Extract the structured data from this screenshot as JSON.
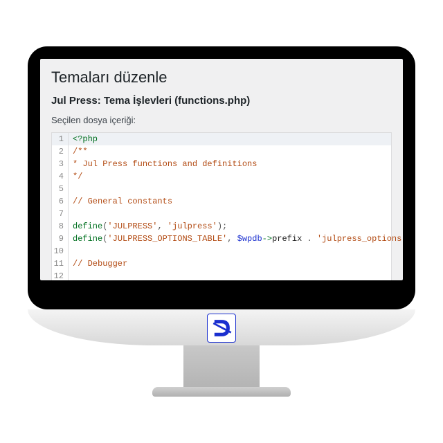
{
  "page": {
    "heading": "Temaları düzenle",
    "subheading": "Jul Press: Tema İşlevleri (functions.php)",
    "file_label": "Seçilen dosya içeriği:"
  },
  "colors": {
    "logo": "#1a2fcf"
  },
  "editor": {
    "active_line": 1,
    "lines": [
      {
        "n": 1,
        "tokens": [
          [
            "k",
            "<?php"
          ]
        ]
      },
      {
        "n": 2,
        "tokens": [
          [
            "c",
            "/**"
          ]
        ]
      },
      {
        "n": 3,
        "tokens": [
          [
            "c",
            " * Jul Press functions and definitions"
          ]
        ]
      },
      {
        "n": 4,
        "tokens": [
          [
            "c",
            " */"
          ]
        ]
      },
      {
        "n": 5,
        "tokens": []
      },
      {
        "n": 6,
        "tokens": [
          [
            "c",
            "// General constants"
          ]
        ]
      },
      {
        "n": 7,
        "tokens": []
      },
      {
        "n": 8,
        "tokens": [
          [
            "k",
            "define"
          ],
          [
            "p",
            "("
          ],
          [
            "s",
            "'JULPRESS'"
          ],
          [
            "p",
            ", "
          ],
          [
            "s",
            "'julpress'"
          ],
          [
            "p",
            ");"
          ]
        ]
      },
      {
        "n": 9,
        "tokens": [
          [
            "k",
            "define"
          ],
          [
            "p",
            "("
          ],
          [
            "s",
            "'JULPRESS_OPTIONS_TABLE'"
          ],
          [
            "p",
            ", "
          ],
          [
            "v",
            "$wpdb"
          ],
          [
            "k",
            "->"
          ],
          [
            "n",
            "prefix"
          ],
          [
            "p",
            " . "
          ],
          [
            "s",
            "'julpress_options'"
          ],
          [
            "p",
            ");"
          ]
        ]
      },
      {
        "n": 10,
        "tokens": []
      },
      {
        "n": 11,
        "tokens": [
          [
            "c",
            "// Debugger"
          ]
        ]
      },
      {
        "n": 12,
        "tokens": []
      }
    ]
  }
}
